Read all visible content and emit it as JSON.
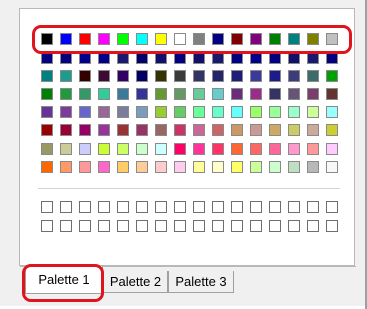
{
  "palette_rows": [
    [
      "#000000",
      "#0000ff",
      "#ff0000",
      "#ff00ff",
      "#00ff00",
      "#00ffff",
      "#ffff00",
      "#ffffff",
      "#808080",
      "#000080",
      "#800000",
      "#800080",
      "#008000",
      "#008080",
      "#808000",
      "#c0c0c0"
    ],
    [
      "#000080",
      "#000080",
      "#00008b",
      "#00008b",
      "#191970",
      "#00006b",
      "#10106a",
      "#000080",
      "#10106a",
      "#191970",
      "#000080",
      "#00008b",
      "#000080",
      "#10106a",
      "#191970",
      "#000080"
    ],
    [
      "#008080",
      "#1c9c8c",
      "#330000",
      "#3d0a33",
      "#330066",
      "#000066",
      "#333300",
      "#3a3a3a",
      "#333366",
      "#24246d",
      "#1e1e7a",
      "#3a3a9c",
      "#1c1c8c",
      "#3c3c7c",
      "#3c6b6b",
      "#00a000"
    ],
    [
      "#008000",
      "#1e9c3c",
      "#339966",
      "#33cc99",
      "#3c7a9c",
      "#333399",
      "#669933",
      "#669966",
      "#66cc99",
      "#66cccc",
      "#6c2c7c",
      "#9c2c8c",
      "#333366",
      "#665577",
      "#7c3c6c",
      "#663333"
    ],
    [
      "#663399",
      "#7c3c9c",
      "#6666cc",
      "#996699",
      "#7c7c9c",
      "#7c9cbc",
      "#99cc33",
      "#66cc66",
      "#66ff99",
      "#66ffcc",
      "#66ffff",
      "#99ff66",
      "#99ff99",
      "#99ffcc",
      "#ccff99",
      "#99ffff"
    ],
    [
      "#990000",
      "#990033",
      "#990066",
      "#993399",
      "#993333",
      "#993366",
      "#996666",
      "#cc3366",
      "#cc6699",
      "#cc6666",
      "#cc9966",
      "#cc9999",
      "#ccaa66",
      "#cccc66",
      "#ccaa99",
      "#cccc33"
    ],
    [
      "#999966",
      "#cccc99",
      "#ccccff",
      "#ccff33",
      "#ccff66",
      "#ccffcc",
      "#ccffff",
      "#ff0066",
      "#ff3399",
      "#ff3366",
      "#ff6633",
      "#ff6666",
      "#ff6699",
      "#ff99cc",
      "#ff9999",
      "#ffccff"
    ],
    [
      "#ff6600",
      "#ff9966",
      "#ff9999",
      "#ff66cc",
      "#ffcc66",
      "#ffcc99",
      "#ffcccc",
      "#ffccee",
      "#ffff99",
      "#ffffcc",
      "#ffff66",
      "#ccff99",
      "#ccffcc",
      "#bfe0c0",
      "#b8b8b8",
      "#f8f8f8"
    ]
  ],
  "custom_rows": 2,
  "custom_cols": 16,
  "tabs": [
    {
      "label": "Palette 1",
      "active": true
    },
    {
      "label": "Palette 2",
      "active": false
    },
    {
      "label": "Palette 3",
      "active": false
    }
  ],
  "highlight_color": "#e0141e"
}
